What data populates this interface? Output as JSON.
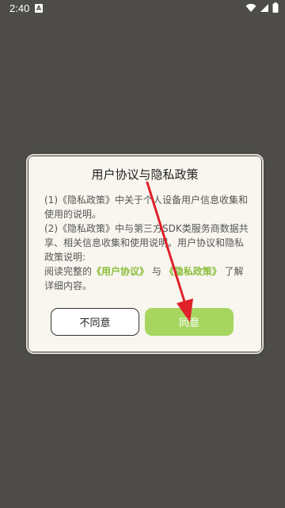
{
  "status_bar": {
    "time": "2:40",
    "notification_glyph": "A"
  },
  "dialog": {
    "title": "用户协议与隐私政策",
    "body": {
      "line1": "(1)《隐私政策》中关于个人设备用户信息收集和使用的说明。",
      "line2": "(2)《隐私政策》中与第三方SDK类服务商数据共享、相关信息收集和使用说明。用户协议和隐私政策说明:",
      "read_prefix": "阅读完整的",
      "user_agreement_link": "《用户协议》",
      "connector": "与",
      "privacy_link": "《隐私政策》",
      "read_suffix": "了解详细内容。"
    },
    "disagree_label": "不同意",
    "agree_label": "同意"
  },
  "colors": {
    "background": "#4d4c48",
    "accent": "#a6d660",
    "link": "#8bbd3a",
    "arrow": "#e0202a"
  }
}
